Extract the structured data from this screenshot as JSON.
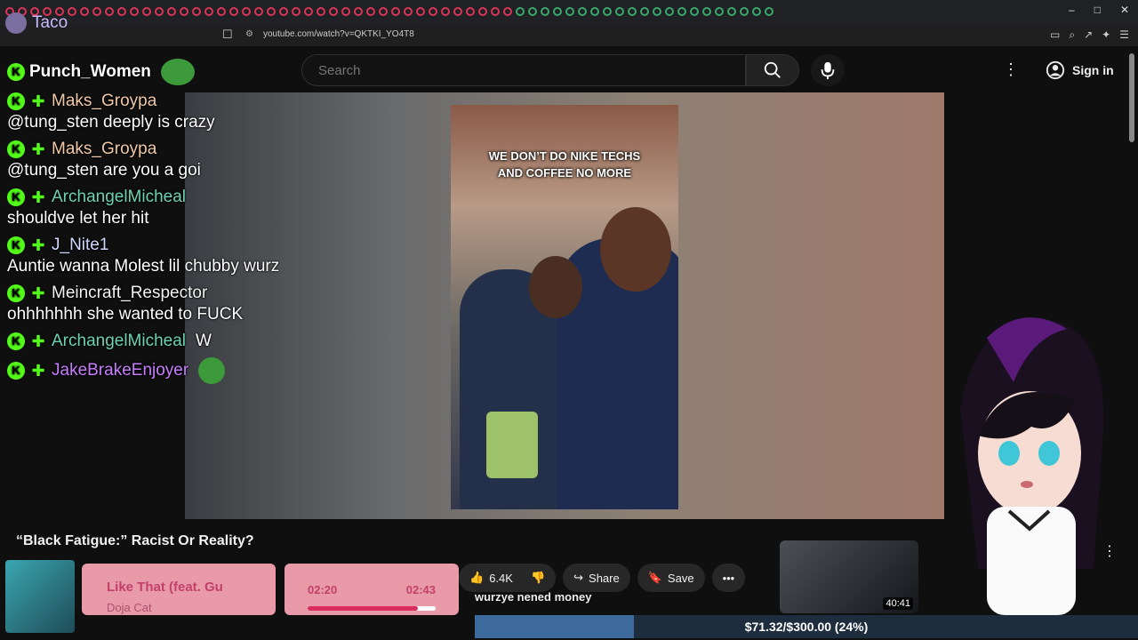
{
  "browser": {
    "url": "youtube.com/watch?v=QKTKI_YO4T8",
    "brand_name": "Taco",
    "window_controls": [
      "–",
      "□",
      "✕"
    ]
  },
  "youtube": {
    "search_placeholder": "Search",
    "signin_label": "Sign in",
    "video_title": "“Black Fatigue:” Racist Or Reality?",
    "like_count": "6.4K",
    "share_label": "Share",
    "save_label": "Save",
    "caption_line1": "WE DON’T DO NIKE TECHS",
    "caption_line2": "AND COFFEE NO MORE",
    "recommended_duration": "40:41"
  },
  "chat": {
    "top_user": "Punch_Women",
    "messages": [
      {
        "user": "Maks_Groypa",
        "color": "#f0c8a6",
        "text": "@tung_sten deeply is crazy"
      },
      {
        "user": "Maks_Groypa",
        "color": "#f0c8a6",
        "text": "@tung_sten are you a goi"
      },
      {
        "user": "ArchangelMicheal",
        "color": "#6cd3b2",
        "text": "shouldve let her hit"
      },
      {
        "user": "J_Nite1",
        "color": "#cfd8ff",
        "text": "Auntie wanna Molest lil chubby wurz"
      },
      {
        "user": "Meincraft_Respector",
        "color": "#f2f2f2",
        "text": "ohhhhhhh she wanted to FUCK"
      },
      {
        "user": "ArchangelMicheal",
        "color": "#6cd3b2",
        "text": "W",
        "inline": true
      },
      {
        "user": "JakeBrakeEnjoyer",
        "color": "#c77dff",
        "text": ""
      }
    ]
  },
  "now_playing": {
    "song": "Like That (feat. Gu",
    "artist": "Doja Cat",
    "elapsed": "02:20",
    "total": "02:43",
    "progress": 0.86
  },
  "donation": {
    "last_donor_text": "wurzye nened money",
    "goal_text": "$71.32/$300.00 (24%)",
    "goal_fraction": 0.24
  },
  "colors": {
    "kick_green": "#53fc18",
    "overlay_pink": "#e89aa9",
    "overlay_text": "#c2406a",
    "goal_bar": "#3d6a9c"
  }
}
